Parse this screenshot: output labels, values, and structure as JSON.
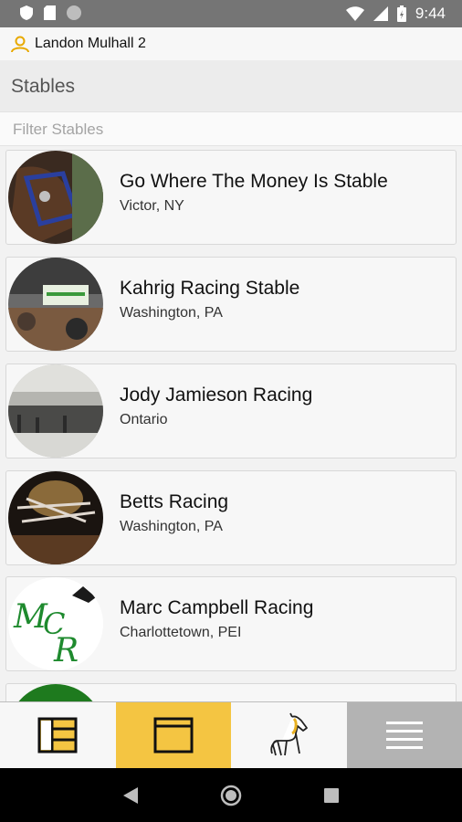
{
  "status_bar": {
    "time": "9:44"
  },
  "user": {
    "name": "Landon Mulhall 2"
  },
  "section": {
    "title": "Stables"
  },
  "filter": {
    "placeholder": "Filter Stables"
  },
  "stables": [
    {
      "name": "Go Where The Money Is Stable",
      "location": "Victor, NY"
    },
    {
      "name": "Kahrig Racing Stable",
      "location": "Washington, PA"
    },
    {
      "name": "Jody Jamieson Racing",
      "location": "Ontario"
    },
    {
      "name": "Betts Racing",
      "location": "Washington, PA"
    },
    {
      "name": "Marc Campbell Racing",
      "location": "Charlottetown, PEI"
    }
  ],
  "tabs": [
    {
      "icon": "table-icon"
    },
    {
      "icon": "stable-icon",
      "active": true
    },
    {
      "icon": "horse-icon"
    },
    {
      "icon": "menu-icon"
    }
  ],
  "colors": {
    "accent": "#f4c542",
    "status_bar": "#757575",
    "menu_tab": "#b3b3b3"
  }
}
